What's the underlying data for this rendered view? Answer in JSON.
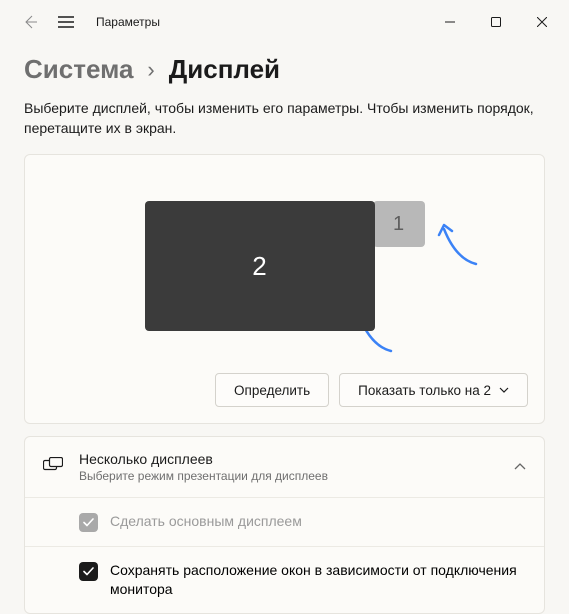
{
  "titlebar": {
    "app_title": "Параметры"
  },
  "breadcrumb": {
    "parent": "Система",
    "sep": "›",
    "current": "Дисплей"
  },
  "description": "Выберите дисплей, чтобы изменить его параметры. Чтобы изменить порядок, перетащите их в экран.",
  "monitors": {
    "primary": "2",
    "secondary": "1"
  },
  "actions": {
    "identify": "Определить",
    "show_only": "Показать только на 2"
  },
  "multi": {
    "title": "Несколько дисплеев",
    "subtitle": "Выберите режим презентации для дисплеев",
    "make_primary": "Сделать основным дисплеем",
    "remember_layout": "Сохранять расположение окон в зависимости от подключения монитора"
  }
}
